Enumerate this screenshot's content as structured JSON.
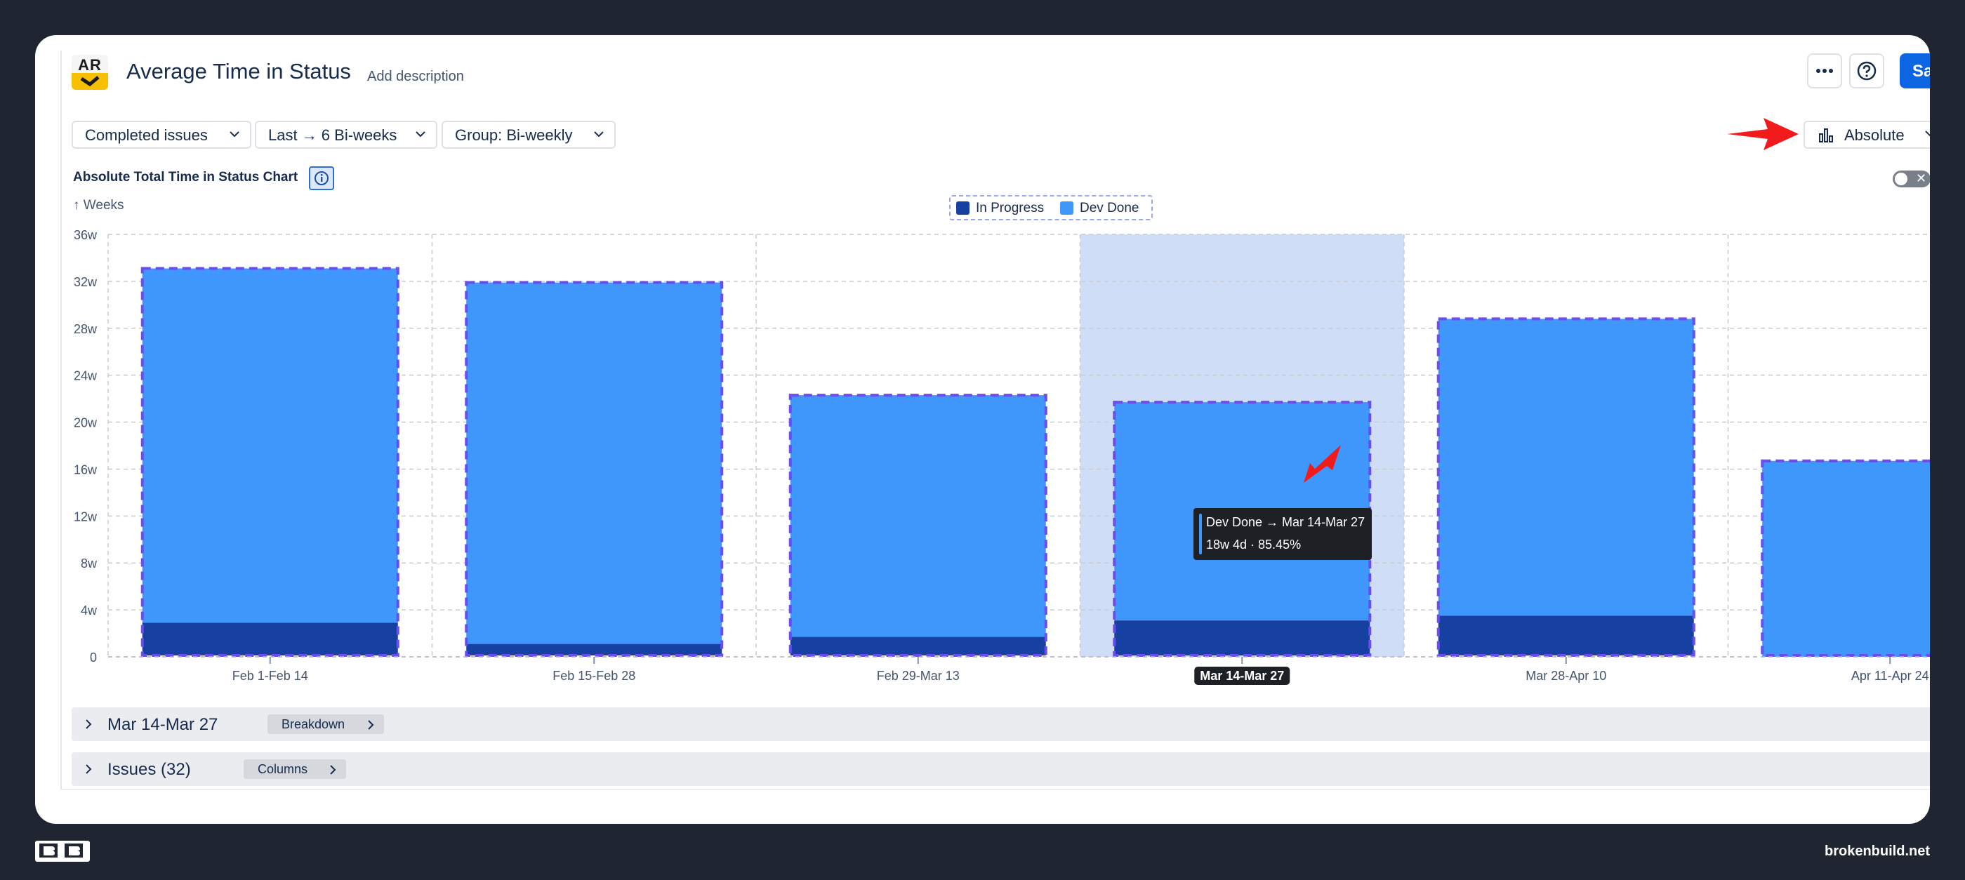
{
  "header": {
    "logo_text": "AR",
    "title": "Average Time in Status",
    "add_description": "Add description",
    "save_label": "Sa"
  },
  "filters": {
    "issues": "Completed issues",
    "range": "Last → 6 Bi-weeks",
    "group": "Group: Bi-weekly",
    "view_mode": "Absolute"
  },
  "chart_header": {
    "title": "Absolute Total Time in Status Chart",
    "y_unit": "Weeks"
  },
  "colors": {
    "in_progress": "#1740a3",
    "dev_done": "#4097fb",
    "highlight": "#cfdef6",
    "annotation_arrow": "#f21b1b"
  },
  "chart_data": {
    "type": "bar",
    "stacked": true,
    "categories": [
      "Feb 1-Feb 14",
      "Feb 15-Feb 28",
      "Feb 29-Mar 13",
      "Mar 14-Mar 27",
      "Mar 28-Apr 10",
      "Apr 11-Apr 24"
    ],
    "series": [
      {
        "name": "In Progress",
        "values": [
          2.9,
          1.1,
          1.7,
          3.1,
          3.5,
          0.0
        ]
      },
      {
        "name": "Dev Done",
        "values": [
          30.2,
          30.8,
          20.6,
          18.6,
          25.3,
          16.7
        ]
      }
    ],
    "y_ticks": [
      "0",
      "4w",
      "8w",
      "12w",
      "16w",
      "20w",
      "24w",
      "28w",
      "32w",
      "36w"
    ],
    "ylim": [
      0,
      36
    ],
    "y_unit": "weeks",
    "selected_category": "Mar 14-Mar 27",
    "grid": true,
    "legend": "top-center"
  },
  "tooltip": {
    "line1": "Dev Done → Mar 14-Mar 27",
    "line2": "18w 4d · 85.45%"
  },
  "sections": {
    "breakdown": {
      "title": "Mar 14-Mar 27",
      "pill": "Breakdown"
    },
    "issues": {
      "title": "Issues (32)",
      "pill": "Columns"
    }
  },
  "footer": {
    "site": "brokenbuild.net"
  }
}
